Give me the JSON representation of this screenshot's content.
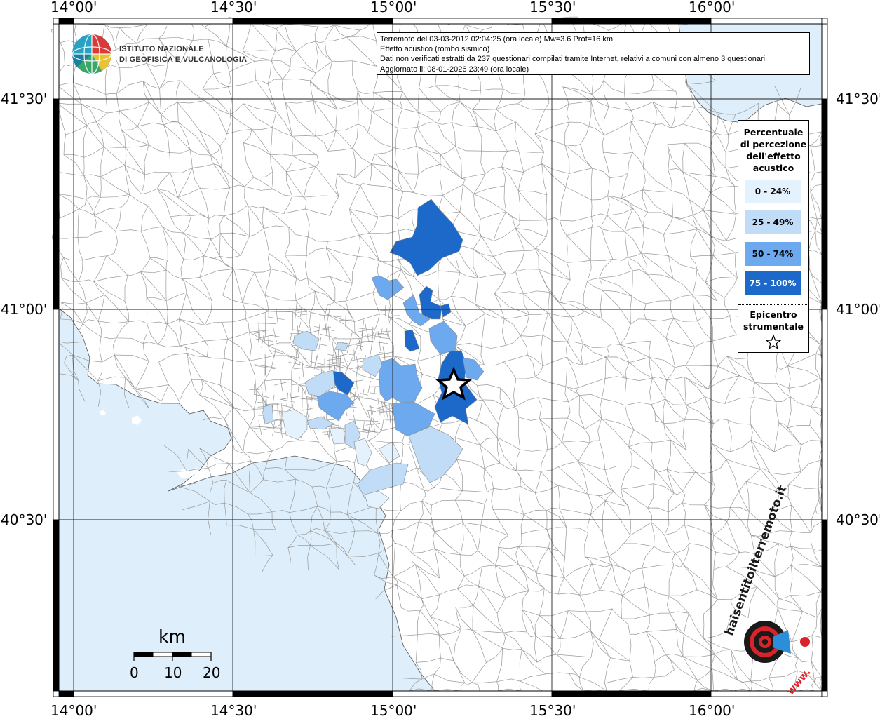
{
  "window_title": "Terremoto del 03-03-2012 - Mappa effetto acustico",
  "colors": {
    "sea": "#deeffb",
    "class_0_24": "#e4f2fd",
    "class_25_49": "#c0dcf7",
    "class_50_74": "#6da9ef",
    "class_75_100": "#1c69c9"
  },
  "axes": {
    "top_lon_labels": [
      "14°00'",
      "14°30'",
      "15°00'",
      "15°30'",
      "16°00'"
    ],
    "bottom_lon_labels": [
      "14°00'",
      "14°30'",
      "15°00'",
      "15°30'",
      "16°00'"
    ],
    "left_lat_labels": [
      "41°30'",
      "41°00'",
      "40°30'"
    ],
    "right_lat_labels": [
      "41°30'",
      "41°00'",
      "40°30'"
    ]
  },
  "logo": {
    "icon": "ingv-globe-icon",
    "line1": "ISTITUTO NAZIONALE",
    "line2": "DI GEOFISICA E VULCANOLOGIA"
  },
  "info": {
    "line1": "Terremoto del 03-03-2012 02:04:25 (ora locale) Mw=3.6 Prof=16 km",
    "line2": "Effetto acustico (rombo sismico)",
    "line3": "Dati non verificati estratti da 237 questionari compilati tramite Internet, relativi a comuni con almeno 3 questionari.",
    "line4": "Aggiornato il: 08-01-2026 23:49 (ora locale)"
  },
  "legend": {
    "title_lines": [
      "Percentuale",
      "di percezione",
      "dell'effetto",
      "acustico"
    ],
    "classes": [
      {
        "label": "0 - 24%"
      },
      {
        "label": "25 - 49%"
      },
      {
        "label": "50 - 74%"
      },
      {
        "label": "75 - 100%"
      }
    ],
    "epicenter_lines": [
      "Epicentro",
      "strumentale"
    ],
    "epicenter_icon": "star-icon"
  },
  "scale": {
    "unit": "km",
    "ticks": [
      "0",
      "10",
      "20"
    ]
  },
  "brand": {
    "icon": "hai-sentito-il-terremoto-icon",
    "text": "haisentitoilterremoto.it",
    "url_text": "www."
  }
}
